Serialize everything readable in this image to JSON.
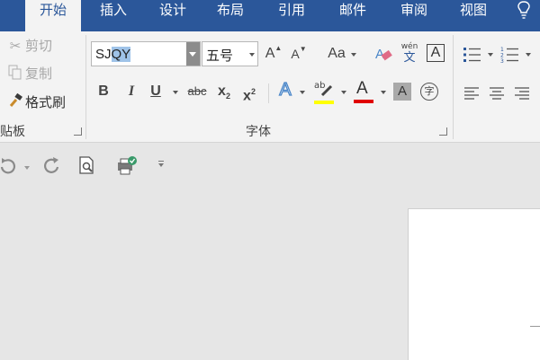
{
  "tabs": [
    "开始",
    "插入",
    "设计",
    "布局",
    "引用",
    "邮件",
    "审阅",
    "视图"
  ],
  "tab_active_index": 0,
  "help_icon": "lightbulb-icon",
  "clipboard": {
    "cut_label": "剪切",
    "copy_label": "复制",
    "format_painter_label": "格式刷",
    "group_label": "贴板"
  },
  "font_group": {
    "font_name_unselected": "SJ",
    "font_name_selected": "QY",
    "font_size": "五号",
    "change_case_label": "Aa",
    "phonetic_top": "wén",
    "phonetic_bottom": "文",
    "border_char": "A",
    "bold": "B",
    "italic": "I",
    "underline": "U",
    "strikethrough": "abc",
    "subscript_base": "x",
    "subscript_mark": "2",
    "superscript_base": "x",
    "superscript_mark": "2",
    "text_effect": "A",
    "highlight_label": "ab",
    "font_color_label": "A",
    "shading_label": "A",
    "enclose_label": "字",
    "group_label": "字体"
  },
  "colors": {
    "tab_bar": "#2b579a",
    "ribbon": "#f3f3f3",
    "highlight": "#ffff00",
    "font_color": "#e00000",
    "text_effect": "#4a86c8"
  }
}
